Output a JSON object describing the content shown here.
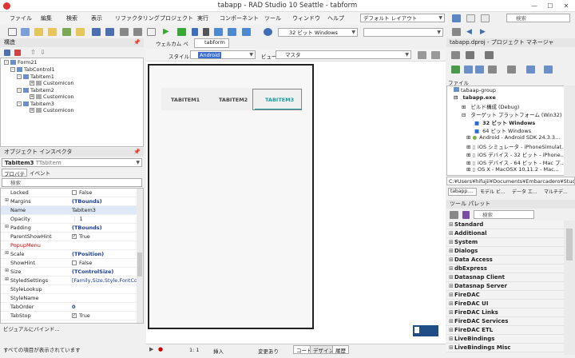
{
  "window": {
    "title": "tabapp - RAD Studio 10 Seattle - tabform",
    "min": "—",
    "max": "☐",
    "close": "✕"
  },
  "menu": [
    "ファイル",
    "編集",
    "検索",
    "表示",
    "リファクタリング",
    "プロジェクト",
    "実行",
    "コンポーネント",
    "ツール",
    "ウィンドウ",
    "ヘルプ"
  ],
  "layout_combo": "デフォルト レイアウト",
  "search_top": "検索",
  "platform_combo": "32 ビット Windows",
  "editor_tabs": [
    "ウェルカム ページ",
    "tabform"
  ],
  "structure": {
    "title": "構造",
    "tree": [
      "Form21",
      "TabControl1",
      "TabItem1",
      "CustomIcon",
      "TabItem2",
      "CustomIcon",
      "TabItem3",
      "CustomIcon"
    ]
  },
  "designer": {
    "style_label": "スタイル:",
    "style_value": "Android",
    "view_label": "ビュー:",
    "view_value": "マスタ",
    "tabs": [
      "TABITEM1",
      "TABITEM2",
      "TABITEM3"
    ],
    "accent": "#1a9ba0"
  },
  "inspector": {
    "title": "オブジェクト インスペクタ",
    "object": "TabItem3",
    "object_type": "TTabItem",
    "tabs": [
      "プロパティ",
      "イベント"
    ],
    "search": "検索",
    "props": [
      {
        "k": "Locked",
        "v": "False",
        "cb": "off"
      },
      {
        "k": "Margins",
        "v": "(TBounds)",
        "exp": "+",
        "bold": true
      },
      {
        "k": "Name",
        "v": "TabItem3",
        "sel": true
      },
      {
        "k": "Opacity",
        "v": "1"
      },
      {
        "k": "Padding",
        "v": "(TBounds)",
        "exp": "+",
        "bold": true
      },
      {
        "k": "ParentShowHint",
        "v": "True",
        "cb": "on"
      },
      {
        "k": "PopupMenu",
        "v": "",
        "red": true
      },
      {
        "k": "Scale",
        "v": "(TPosition)",
        "exp": "+",
        "bold": true
      },
      {
        "k": "ShowHint",
        "v": "False",
        "cb": "off"
      },
      {
        "k": "Size",
        "v": "(TControlSize)",
        "exp": "+",
        "bold": true
      },
      {
        "k": "StyledSettings",
        "v": "[Family,Size,Style,FontColor]",
        "exp": "+"
      },
      {
        "k": "StyleLookup",
        "v": ""
      },
      {
        "k": "StyleName",
        "v": ""
      },
      {
        "k": "TabOrder",
        "v": "0",
        "bold": true
      },
      {
        "k": "TabStop",
        "v": "True",
        "cb": "on"
      }
    ],
    "bind": "ビジュアルにバインド...",
    "status": "すべての項目が表示されています"
  },
  "editor_status": {
    "pos": "1: 1",
    "mode": "挿入",
    "modified": "変更あり",
    "tabs": [
      "コード",
      "デザイン",
      "履歴"
    ]
  },
  "project": {
    "title": "tabapp.dproj - プロジェクト マネージャ",
    "file_label": "ファイル",
    "tree": [
      "tabaap-group",
      "tabapp.exe",
      "ビルド構成 (Debug)",
      "ターゲット プラットフォーム (Win32)",
      "32 ビット Windows",
      "64 ビット Windows",
      "Android - Android SDK 24.3.3...",
      "iOS シミュレータ - iPhoneSimulat...",
      "iOS デバイス - 32 ビット - iPhone...",
      "iOS デバイス - 64 ビット - Mac プ...",
      "OS X - MacOSX 10.11.2 - Mac..."
    ],
    "path": "C:¥Users¥hifujii¥Documents¥Embarcadero¥Stud",
    "tabs": [
      "tabapp....",
      "モデル ビ...",
      "データ エ...",
      "マルチデ..."
    ]
  },
  "palette": {
    "title": "ツール パレット",
    "search": "検索",
    "cats": [
      "Standard",
      "Additional",
      "System",
      "Dialogs",
      "Data Access",
      "dbExpress",
      "Datasnap Client",
      "Datasnap Server",
      "FireDAC",
      "FireDAC UI",
      "FireDAC Links",
      "FireDAC Services",
      "FireDAC ETL",
      "LiveBindings",
      "LiveBindings Misc"
    ]
  }
}
